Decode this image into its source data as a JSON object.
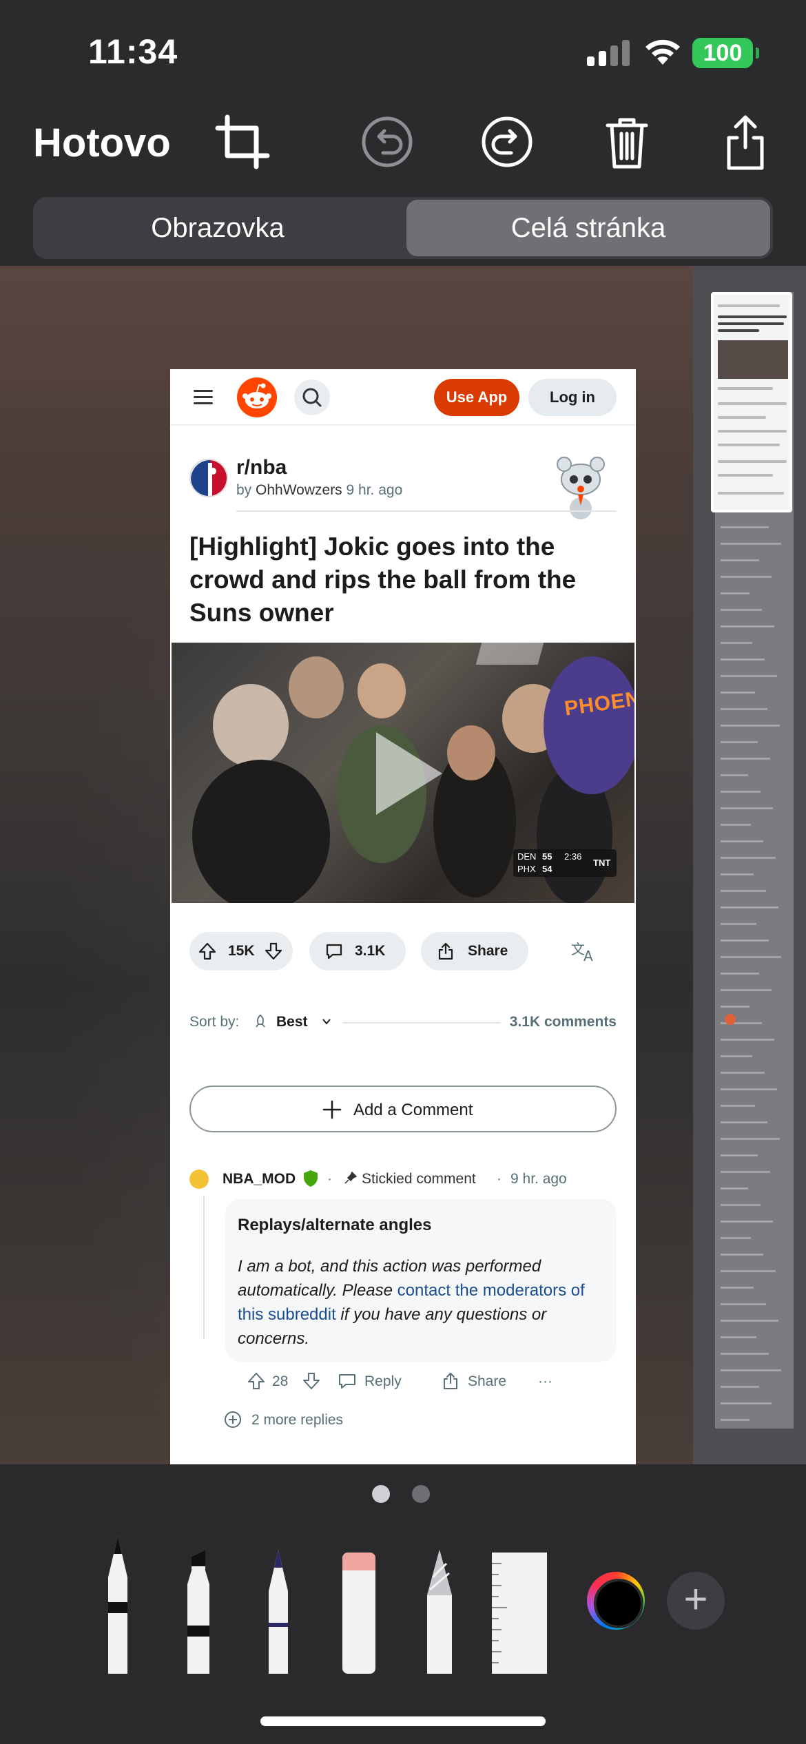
{
  "status_bar": {
    "time": "11:34",
    "battery": "100",
    "battery_color": "#34c759"
  },
  "toolbar": {
    "done_label": "Hotovo",
    "icons": [
      "crop-icon",
      "undo-icon",
      "redo-icon",
      "trash-icon",
      "share-icon"
    ]
  },
  "segmented": {
    "options": [
      "Obrazovka",
      "Celá stránka"
    ],
    "selected": "Celá stránka"
  },
  "reddit": {
    "header": {
      "use_app": "Use App",
      "log_in": "Log in",
      "accent": "#d93a00"
    },
    "post": {
      "subreddit": "r/nba",
      "by": "by",
      "author": "OhhWowzers",
      "age": "9 hr. ago",
      "title": "[Highlight] Jokic goes into the crowd and rips the ball from the Suns owner",
      "video": {
        "jersey_text": "PHOENIX",
        "score_away_team": "DEN",
        "score_home_team": "PHX",
        "score_away": "55",
        "score_home": "54",
        "clock": "2:36",
        "network": "TNT"
      },
      "upvotes": "15K",
      "comments_count": "3.1K",
      "share": "Share"
    },
    "sort": {
      "label": "Sort by:",
      "value": "Best",
      "total_comments": "3.1K comments"
    },
    "add_comment": "Add a Comment",
    "comment": {
      "author": "NBA_MOD",
      "stickied": "Stickied comment",
      "age": "9 hr. ago",
      "heading": "Replays/alternate angles",
      "body_part1": "I am a bot, and this action was performed automatically. Please ",
      "body_link": "contact the moderators of this subreddit",
      "body_part2": " if you have any questions or concerns.",
      "score": "28",
      "reply": "Reply",
      "share": "Share",
      "more": "···",
      "more_replies": "2 more replies"
    }
  },
  "tools": {
    "items": [
      "pen-tool",
      "marker-tool",
      "pencil-tool",
      "eraser-tool",
      "lasso-tool",
      "ruler-tool"
    ],
    "selected_color": "#000000"
  }
}
